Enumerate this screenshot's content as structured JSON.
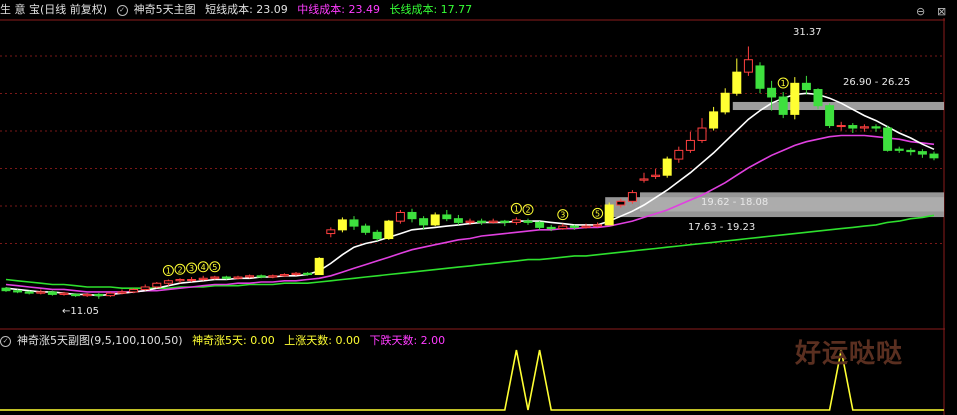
{
  "header": {
    "title_prefix": "生 意 宝(日线 前复权)",
    "indicator_name": "神奇5天主图",
    "short_label": "短线成本: 23.09",
    "mid_label": "中线成本: 23.49",
    "long_label": "长线成本: 17.77"
  },
  "sub_header": {
    "indicator_name": "神奇涨5天副图(9,5,100,100,50)",
    "v1_label": "神奇涨5天: 0.00",
    "v2_label": "上涨天数: 0.00",
    "v3_label": "下跌天数: 2.00"
  },
  "annotations": {
    "high": "31.37",
    "low": "11.05",
    "zone_top": "26.90 - 26.25",
    "zone_mid": "19.62 - 18.08",
    "zone_low": "17.63 - 19.23"
  },
  "watermark": "好运哒哒",
  "colors": {
    "up": "#ff4040",
    "down": "#3ee03e",
    "yellow": "#ffff33",
    "short": "#ffffff",
    "mid": "#e040e0",
    "long": "#2ee02e"
  },
  "chart_data": {
    "type": "candlestick",
    "ylim": [
      9.5,
      33.5
    ],
    "candles": [
      [
        11.9,
        11.7,
        12.0,
        11.6
      ],
      [
        11.7,
        11.6,
        11.8,
        11.5
      ],
      [
        11.6,
        11.5,
        11.7,
        11.4
      ],
      [
        11.5,
        11.6,
        11.8,
        11.4
      ],
      [
        11.6,
        11.4,
        11.7,
        11.3
      ],
      [
        11.4,
        11.5,
        11.6,
        11.3
      ],
      [
        11.4,
        11.3,
        11.5,
        11.2
      ],
      [
        11.3,
        11.4,
        11.5,
        11.2
      ],
      [
        11.4,
        11.3,
        11.5,
        11.05
      ],
      [
        11.3,
        11.5,
        11.6,
        11.2
      ],
      [
        11.5,
        11.6,
        11.8,
        11.4
      ],
      [
        11.6,
        11.8,
        11.9,
        11.5
      ],
      [
        11.8,
        12.0,
        12.2,
        11.7
      ],
      [
        12.0,
        12.3,
        12.4,
        11.9
      ],
      [
        12.3,
        12.5,
        12.6,
        12.1
      ],
      [
        12.5,
        12.6,
        12.7,
        12.3
      ],
      [
        12.6,
        12.6,
        12.8,
        12.4
      ],
      [
        12.6,
        12.7,
        12.9,
        12.5
      ],
      [
        12.7,
        12.8,
        12.9,
        12.6
      ],
      [
        12.8,
        12.7,
        12.9,
        12.6
      ],
      [
        12.7,
        12.8,
        12.9,
        12.6
      ],
      [
        12.8,
        12.9,
        13.0,
        12.7
      ],
      [
        12.9,
        12.8,
        13.0,
        12.7
      ],
      [
        12.8,
        12.9,
        13.0,
        12.7
      ],
      [
        12.9,
        13.0,
        13.1,
        12.8
      ],
      [
        13.0,
        13.1,
        13.2,
        12.9
      ],
      [
        13.1,
        13.0,
        13.2,
        12.9
      ],
      [
        13.0,
        14.3,
        14.4,
        13.0
      ],
      [
        16.3,
        16.6,
        16.8,
        16.0
      ],
      [
        16.6,
        17.4,
        17.6,
        16.4
      ],
      [
        17.4,
        16.9,
        17.7,
        16.6
      ],
      [
        16.9,
        16.4,
        17.1,
        16.2
      ],
      [
        16.4,
        15.9,
        16.6,
        15.7
      ],
      [
        15.9,
        17.3,
        17.4,
        15.8
      ],
      [
        17.3,
        18.0,
        18.2,
        17.1
      ],
      [
        18.0,
        17.5,
        18.3,
        17.2
      ],
      [
        17.5,
        17.0,
        17.7,
        16.6
      ],
      [
        17.0,
        17.8,
        18.0,
        16.9
      ],
      [
        17.8,
        17.5,
        18.2,
        17.3
      ],
      [
        17.5,
        17.2,
        17.8,
        17.0
      ],
      [
        17.2,
        17.3,
        17.5,
        17.0
      ],
      [
        17.3,
        17.2,
        17.5,
        17.0
      ],
      [
        17.2,
        17.3,
        17.5,
        17.1
      ],
      [
        17.3,
        17.2,
        17.4,
        16.9
      ],
      [
        17.2,
        17.4,
        17.6,
        17.0
      ],
      [
        17.3,
        17.2,
        17.5,
        17.0
      ],
      [
        17.2,
        16.8,
        17.3,
        16.6
      ],
      [
        16.8,
        16.7,
        17.0,
        16.5
      ],
      [
        16.7,
        16.9,
        17.1,
        16.6
      ],
      [
        16.9,
        16.8,
        17.0,
        16.6
      ],
      [
        16.8,
        16.9,
        17.1,
        16.7
      ],
      [
        16.9,
        17.0,
        17.2,
        16.8
      ],
      [
        17.0,
        18.6,
        18.8,
        17.0
      ],
      [
        18.6,
        18.9,
        19.1,
        18.4
      ],
      [
        18.9,
        19.6,
        19.8,
        18.7
      ],
      [
        20.6,
        20.7,
        21.2,
        20.4
      ],
      [
        20.9,
        21.0,
        21.5,
        20.7
      ],
      [
        21.0,
        22.3,
        22.5,
        20.8
      ],
      [
        22.3,
        23.0,
        23.3,
        22.0
      ],
      [
        23.0,
        23.8,
        24.5,
        22.8
      ],
      [
        23.8,
        24.8,
        25.6,
        23.6
      ],
      [
        24.8,
        26.1,
        26.5,
        24.6
      ],
      [
        26.1,
        27.6,
        28.0,
        25.9
      ],
      [
        27.6,
        29.3,
        30.4,
        27.4
      ],
      [
        29.3,
        30.3,
        31.37,
        29.0
      ],
      [
        29.8,
        28.0,
        30.1,
        27.6
      ],
      [
        28.0,
        27.3,
        28.6,
        26.2
      ],
      [
        27.3,
        25.9,
        27.7,
        25.6
      ],
      [
        25.9,
        28.4,
        28.9,
        25.5
      ],
      [
        28.4,
        27.9,
        29.0,
        27.5
      ],
      [
        27.9,
        26.6,
        28.0,
        26.3
      ],
      [
        26.6,
        25.0,
        26.8,
        24.8
      ],
      [
        25.0,
        25.0,
        25.3,
        24.6
      ],
      [
        25.0,
        24.8,
        25.2,
        24.4
      ],
      [
        24.8,
        24.9,
        25.1,
        24.5
      ],
      [
        24.9,
        24.8,
        25.1,
        24.5
      ],
      [
        24.8,
        23.0,
        25.0,
        22.9
      ],
      [
        23.1,
        23.0,
        23.3,
        22.8
      ],
      [
        23.0,
        22.9,
        23.2,
        22.6
      ],
      [
        22.9,
        22.7,
        23.1,
        22.4
      ],
      [
        22.7,
        22.4,
        22.9,
        22.2
      ]
    ],
    "short_line": [
      11.9,
      11.8,
      11.7,
      11.6,
      11.6,
      11.5,
      11.4,
      11.4,
      11.3,
      11.4,
      11.5,
      11.6,
      11.7,
      11.9,
      12.1,
      12.3,
      12.4,
      12.5,
      12.6,
      12.6,
      12.7,
      12.7,
      12.8,
      12.8,
      12.9,
      12.9,
      13.0,
      13.3,
      13.9,
      14.6,
      15.2,
      15.5,
      15.7,
      16.0,
      16.3,
      16.6,
      16.7,
      16.8,
      16.9,
      17.0,
      17.1,
      17.2,
      17.2,
      17.2,
      17.3,
      17.3,
      17.3,
      17.2,
      17.1,
      17.0,
      17.0,
      17.0,
      17.3,
      17.7,
      18.1,
      18.6,
      19.2,
      19.8,
      20.5,
      21.2,
      22.0,
      22.8,
      23.7,
      24.6,
      25.5,
      26.2,
      26.8,
      27.2,
      27.5,
      27.6,
      27.5,
      27.2,
      26.8,
      26.3,
      25.8,
      25.4,
      24.9,
      24.4,
      24.0,
      23.5,
      23.09
    ],
    "mid_line": [
      12.2,
      12.1,
      12.0,
      11.9,
      11.8,
      11.8,
      11.7,
      11.6,
      11.6,
      11.6,
      11.6,
      11.6,
      11.7,
      11.7,
      11.8,
      11.9,
      12.0,
      12.1,
      12.2,
      12.2,
      12.3,
      12.3,
      12.4,
      12.4,
      12.5,
      12.5,
      12.6,
      12.7,
      12.9,
      13.2,
      13.5,
      13.8,
      14.1,
      14.4,
      14.7,
      15.0,
      15.2,
      15.4,
      15.6,
      15.8,
      15.9,
      16.1,
      16.2,
      16.3,
      16.4,
      16.5,
      16.6,
      16.6,
      16.7,
      16.7,
      16.8,
      16.8,
      16.9,
      17.1,
      17.3,
      17.6,
      17.9,
      18.2,
      18.6,
      19.0,
      19.4,
      19.9,
      20.4,
      21.0,
      21.6,
      22.1,
      22.6,
      23.0,
      23.4,
      23.7,
      23.9,
      24.1,
      24.2,
      24.2,
      24.2,
      24.1,
      24.0,
      23.9,
      23.7,
      23.6,
      23.49
    ],
    "long_line": [
      12.6,
      12.5,
      12.4,
      12.3,
      12.2,
      12.2,
      12.1,
      12.0,
      12.0,
      12.0,
      11.9,
      11.9,
      11.9,
      11.9,
      11.9,
      12.0,
      12.0,
      12.0,
      12.1,
      12.1,
      12.1,
      12.2,
      12.2,
      12.2,
      12.3,
      12.3,
      12.3,
      12.4,
      12.5,
      12.6,
      12.7,
      12.8,
      12.9,
      13.0,
      13.1,
      13.2,
      13.3,
      13.4,
      13.5,
      13.6,
      13.7,
      13.8,
      13.9,
      14.0,
      14.1,
      14.2,
      14.2,
      14.3,
      14.4,
      14.5,
      14.5,
      14.6,
      14.7,
      14.8,
      14.9,
      15.0,
      15.1,
      15.2,
      15.3,
      15.4,
      15.5,
      15.6,
      15.7,
      15.8,
      15.9,
      16.0,
      16.1,
      16.2,
      16.3,
      16.4,
      16.5,
      16.6,
      16.7,
      16.8,
      16.9,
      17.0,
      17.2,
      17.3,
      17.5,
      17.6,
      17.77
    ],
    "zones": [
      {
        "label": "26.90 - 26.25",
        "lo": 26.25,
        "hi": 26.9,
        "from": 63
      },
      {
        "label": "19.62 - 18.08",
        "lo": 18.08,
        "hi": 19.62,
        "from": 55
      },
      {
        "label": "17.63 - 19.23",
        "lo": 17.63,
        "hi": 19.23,
        "from": 52
      }
    ],
    "markers": [
      {
        "i": 14,
        "label": "1"
      },
      {
        "i": 15,
        "label": "2"
      },
      {
        "i": 16,
        "label": "3"
      },
      {
        "i": 17,
        "label": "4"
      },
      {
        "i": 18,
        "label": "5"
      },
      {
        "i": 44,
        "label": "1"
      },
      {
        "i": 45,
        "label": "2"
      },
      {
        "i": 48,
        "label": "3"
      },
      {
        "i": 51,
        "label": "5"
      },
      {
        "i": 67,
        "label": "1"
      }
    ],
    "sub": {
      "ylim": [
        0,
        1
      ],
      "spikes": [
        44,
        46,
        72
      ]
    }
  }
}
